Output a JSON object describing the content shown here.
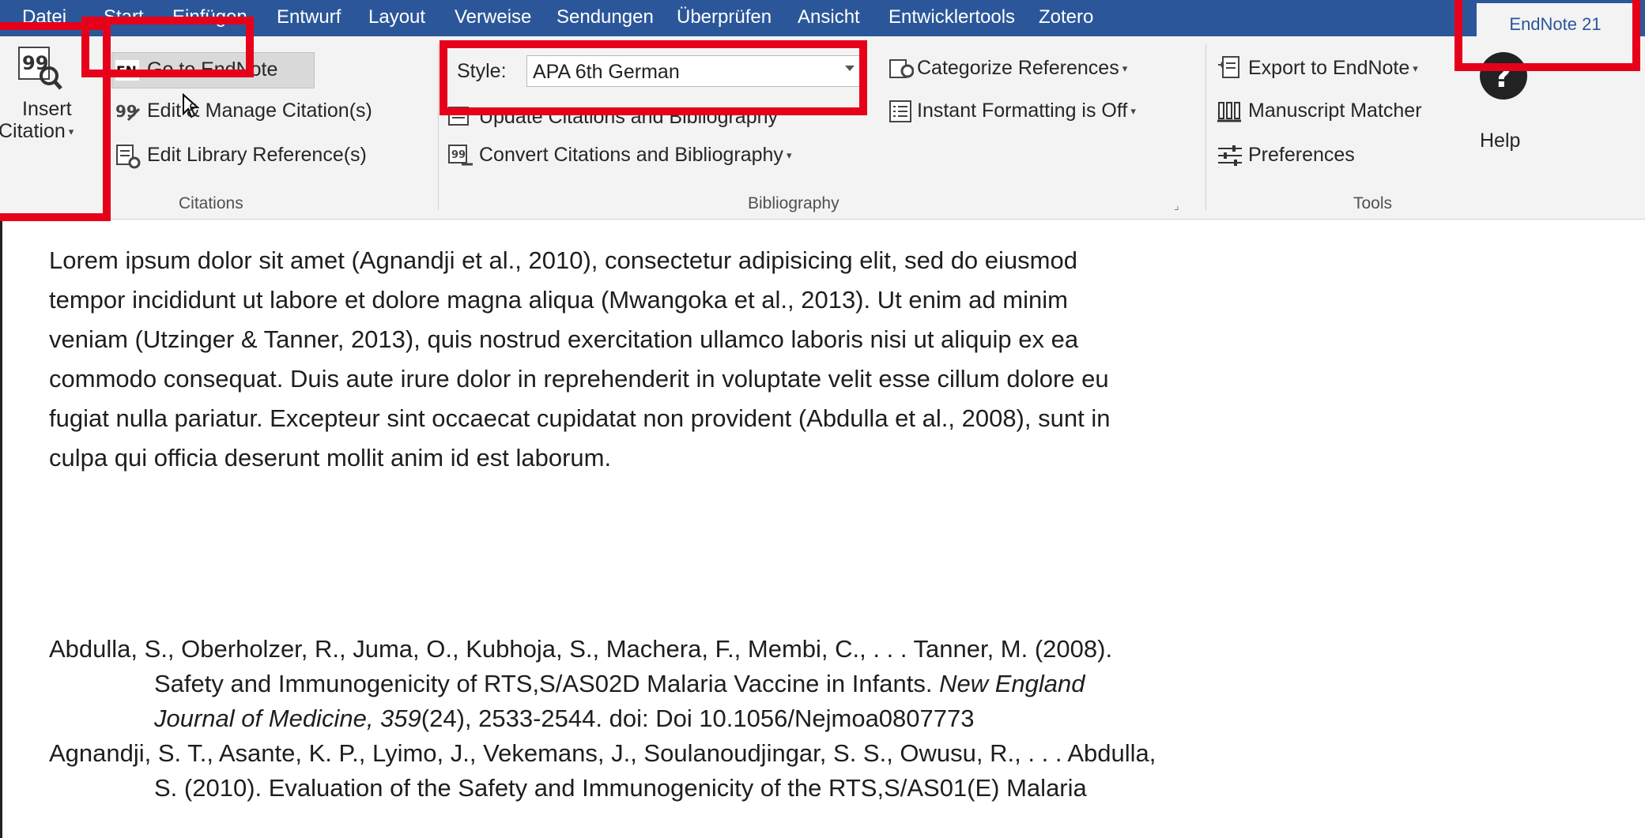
{
  "tabs": [
    "Datei",
    "Start",
    "Einfügen",
    "Entwurf",
    "Layout",
    "Verweise",
    "Sendungen",
    "Überprüfen",
    "Ansicht",
    "Entwicklertools",
    "Zotero",
    "EndNote 21"
  ],
  "citations": {
    "insert_citation_line1": "Insert",
    "insert_citation_line2": "Citation",
    "go_to_endnote": "Go to EndNote",
    "edit_manage": "Edit & Manage Citation(s)",
    "edit_library": "Edit Library Reference(s)",
    "group_label": "Citations"
  },
  "bibliography": {
    "style_label": "Style:",
    "style_value": "APA 6th German",
    "update": "Update Citations and Bibliography",
    "convert": "Convert Citations and Bibliography",
    "categorize": "Categorize References",
    "instant_formatting": "Instant Formatting is Off",
    "group_label": "Bibliography"
  },
  "tools": {
    "export": "Export to EndNote",
    "manuscript_matcher": "Manuscript Matcher",
    "preferences": "Preferences",
    "help": "Help",
    "group_label": "Tools"
  },
  "document": {
    "paragraph_lines": [
      "Lorem ipsum dolor sit amet (Agnandji et al., 2010), consectetur adipisicing elit, sed do eiusmod",
      "tempor incididunt ut labore et dolore magna aliqua (Mwangoka et al., 2013). Ut enim ad minim",
      "veniam (Utzinger & Tanner, 2013), quis nostrud exercitation ullamco laboris nisi ut aliquip ex ea",
      "commodo consequat. Duis aute irure dolor in reprehenderit in voluptate velit esse cillum dolore eu",
      "fugiat nulla pariatur. Excepteur sint occaecat cupidatat non provident (Abdulla et al., 2008), sunt in",
      "culpa qui officia deserunt mollit anim id est laborum."
    ],
    "references": [
      {
        "line1": "Abdulla, S., Oberholzer, R., Juma, O., Kubhoja, S., Machera, F., Membi, C., . . . Tanner, M. (2008).",
        "line2": "Safety and Immunogenicity of RTS,S/AS02D Malaria Vaccine in Infants. ",
        "line2_italic": "New England",
        "line3_italic": "Journal of Medicine, 359",
        "line3": "(24), 2533-2544. doi: Doi 10.1056/Nejmoa0807773"
      },
      {
        "line1": "Agnandji, S. T., Asante, K. P., Lyimo, J., Vekemans, J., Soulanoudjingar, S. S., Owusu, R., . . . Abdulla,",
        "line2": "S. (2010). Evaluation of the Safety and Immunogenicity of the RTS,S/AS01(E) Malaria"
      }
    ]
  },
  "colors": {
    "tabbar": "#2b579a",
    "ribbon": "#f3f3f3",
    "highlight_box": "#e6001a"
  }
}
